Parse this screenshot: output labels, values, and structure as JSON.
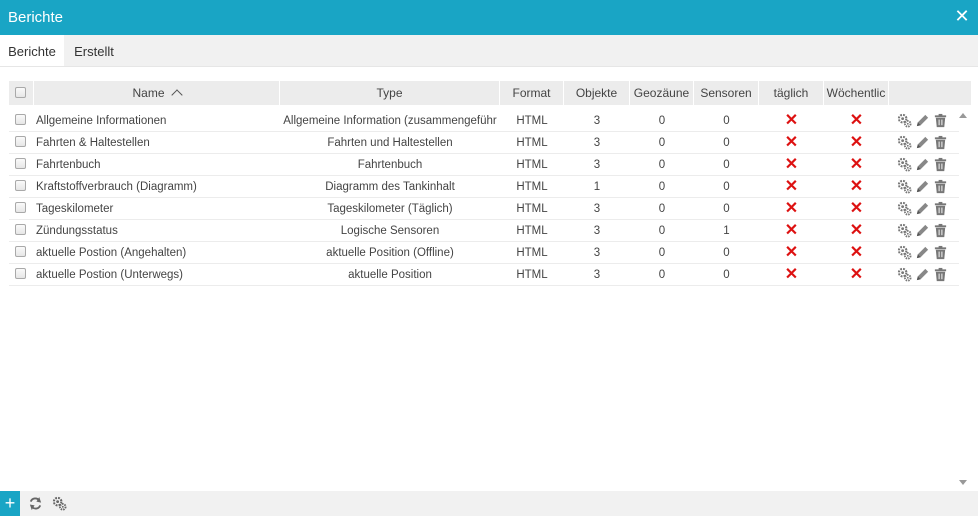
{
  "window": {
    "title": "Berichte",
    "close_icon": "close-icon"
  },
  "tabs": [
    {
      "label": "Berichte",
      "active": true
    },
    {
      "label": "Erstellt",
      "active": false
    }
  ],
  "table": {
    "columns": [
      "Name",
      "Type",
      "Format",
      "Objekte",
      "Geozäune",
      "Sensoren",
      "täglich",
      "Wöchentlic"
    ],
    "sort": {
      "column": "Name",
      "direction": "ascending"
    },
    "rows": [
      {
        "name": "Allgemeine Informationen",
        "type": "Allgemeine Information (zusammengeführ",
        "format": "HTML",
        "objekte": "3",
        "geozaune": "0",
        "sensoren": "0"
      },
      {
        "name": "Fahrten & Haltestellen",
        "type": "Fahrten und Haltestellen",
        "format": "HTML",
        "objekte": "3",
        "geozaune": "0",
        "sensoren": "0"
      },
      {
        "name": "Fahrtenbuch",
        "type": "Fahrtenbuch",
        "format": "HTML",
        "objekte": "3",
        "geozaune": "0",
        "sensoren": "0"
      },
      {
        "name": "Kraftstoffverbrauch (Diagramm)",
        "type": "Diagramm des Tankinhalt",
        "format": "HTML",
        "objekte": "1",
        "geozaune": "0",
        "sensoren": "0"
      },
      {
        "name": "Tageskilometer",
        "type": "Tageskilometer (Täglich)",
        "format": "HTML",
        "objekte": "3",
        "geozaune": "0",
        "sensoren": "0"
      },
      {
        "name": "Zündungsstatus",
        "type": "Logische Sensoren",
        "format": "HTML",
        "objekte": "3",
        "geozaune": "0",
        "sensoren": "1"
      },
      {
        "name": "aktuelle Postion (Angehalten)",
        "type": "aktuelle Position (Offline)",
        "format": "HTML",
        "objekte": "3",
        "geozaune": "0",
        "sensoren": "0"
      },
      {
        "name": "aktuelle Postion (Unterwegs)",
        "type": "aktuelle Position",
        "format": "HTML",
        "objekte": "3",
        "geozaune": "0",
        "sensoren": "0"
      }
    ],
    "icons": {
      "daily": "x-icon",
      "weekly": "x-icon",
      "settings": "gears-icon",
      "edit": "pencil-icon",
      "delete": "trash-icon"
    }
  },
  "footer": {
    "add_label": "+",
    "icons": [
      "plus-icon",
      "refresh-icon",
      "gears-icon"
    ]
  },
  "colors": {
    "accent": "#19a5c5",
    "x_mark": "#dd1111",
    "header_bg": "#ececec"
  }
}
